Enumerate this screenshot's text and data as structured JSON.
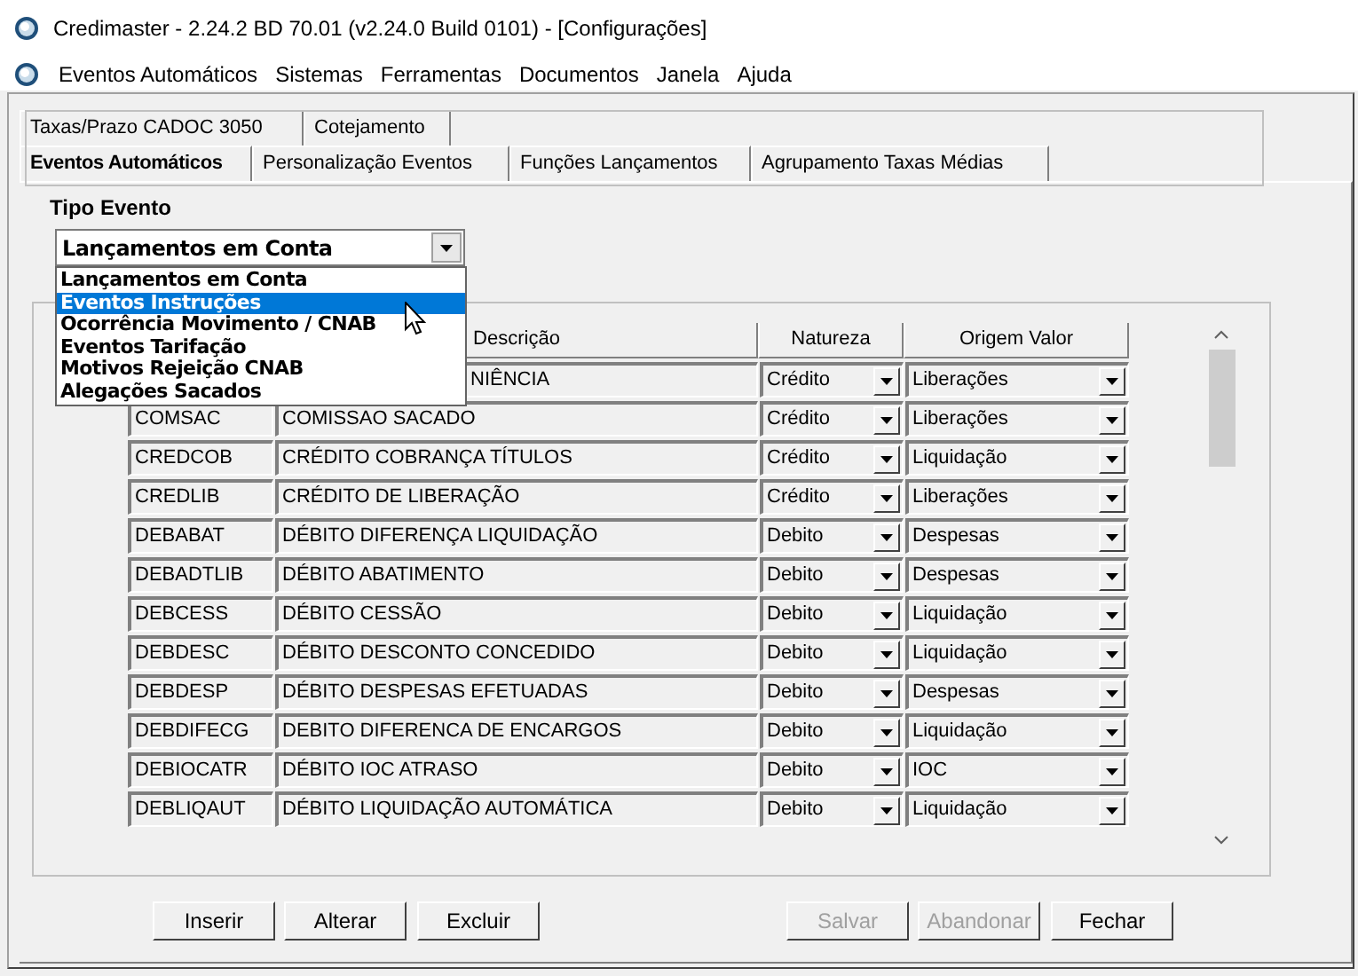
{
  "window": {
    "title": "Credimaster - 2.24.2 BD 70.01 (v2.24.0 Build 0101) - [Configurações]"
  },
  "menu": [
    "Eventos Automáticos",
    "Sistemas",
    "Ferramentas",
    "Documentos",
    "Janela",
    "Ajuda"
  ],
  "tab_rows": [
    [
      {
        "label": "Taxas/Prazo CADOC 3050",
        "selected": false
      },
      {
        "label": "Cotejamento",
        "selected": false
      }
    ],
    [
      {
        "label": "Eventos Automáticos",
        "selected": true
      },
      {
        "label": "Personalização Eventos",
        "selected": false
      },
      {
        "label": "Funções Lançamentos",
        "selected": false
      },
      {
        "label": "Agrupamento Taxas Médias",
        "selected": false
      }
    ]
  ],
  "tipo_evento": {
    "label": "Tipo Evento",
    "value": "Lançamentos em Conta",
    "options": [
      {
        "label": "Lançamentos em Conta",
        "highlighted": false
      },
      {
        "label": "Eventos Instruções",
        "highlighted": true
      },
      {
        "label": "Ocorrência Movimento / CNAB",
        "highlighted": false
      },
      {
        "label": "Eventos Tarifação",
        "highlighted": false
      },
      {
        "label": "Motivos Rejeição CNAB",
        "highlighted": false
      },
      {
        "label": "Alegações Sacados",
        "highlighted": false
      }
    ]
  },
  "table": {
    "columns": [
      "Descrição",
      "Natureza",
      "Origem Valor"
    ],
    "rows": [
      {
        "description": "NIÊNCIA",
        "covered": true,
        "natureza": "Crédito",
        "origem": "Liberações"
      },
      {
        "code": "COMSAC",
        "description": "COMISSAO SACADO",
        "natureza": "Crédito",
        "origem": "Liberações"
      },
      {
        "code": "CREDCOB",
        "description": "CRÉDITO COBRANÇA TÍTULOS",
        "natureza": "Crédito",
        "origem": "Liquidação"
      },
      {
        "code": "CREDLIB",
        "description": "CRÉDITO DE LIBERAÇÃO",
        "natureza": "Crédito",
        "origem": "Liberações"
      },
      {
        "code": "DEBABAT",
        "description": "DÉBITO DIFERENÇA LIQUIDAÇÃO",
        "natureza": "Debito",
        "origem": "Despesas"
      },
      {
        "code": "DEBADTLIB",
        "description": "DÉBITO ABATIMENTO",
        "natureza": "Debito",
        "origem": "Despesas"
      },
      {
        "code": "DEBCESS",
        "description": "DÉBITO CESSÃO",
        "natureza": "Debito",
        "origem": "Liquidação"
      },
      {
        "code": "DEBDESC",
        "description": "DÉBITO DESCONTO CONCEDIDO",
        "natureza": "Debito",
        "origem": "Liquidação"
      },
      {
        "code": "DEBDESP",
        "description": "DÉBITO DESPESAS EFETUADAS",
        "natureza": "Debito",
        "origem": "Despesas"
      },
      {
        "code": "DEBDIFECG",
        "description": "DEBITO DIFERENCA DE ENCARGOS",
        "natureza": "Debito",
        "origem": "Liquidação"
      },
      {
        "code": "DEBIOCATR",
        "description": "DÉBITO IOC ATRASO",
        "natureza": "Debito",
        "origem": "IOC"
      },
      {
        "code": "DEBLIQAUT",
        "description": "DÉBITO LIQUIDAÇÃO AUTOMÁTICA",
        "natureza": "Debito",
        "origem": "Liquidação"
      }
    ]
  },
  "buttons": [
    {
      "label": "Inserir",
      "disabled": false
    },
    {
      "label": "Alterar",
      "disabled": false
    },
    {
      "label": "Excluir",
      "disabled": false
    },
    {
      "label": "Salvar",
      "disabled": true
    },
    {
      "label": "Abandonar",
      "disabled": true
    },
    {
      "label": "Fechar",
      "disabled": false
    }
  ]
}
